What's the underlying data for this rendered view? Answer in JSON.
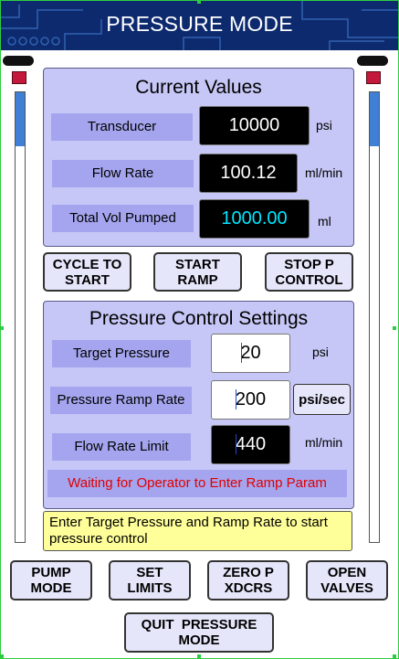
{
  "header": {
    "title": "PRESSURE MODE"
  },
  "current_values": {
    "title": "Current Values",
    "rows": [
      {
        "label": "Transducer",
        "value": "10000",
        "unit": "psi"
      },
      {
        "label": "Flow Rate",
        "value": "100.12",
        "unit": "ml/min"
      },
      {
        "label": "Total Vol Pumped",
        "value": "1000.00",
        "unit": "ml"
      }
    ]
  },
  "mid_buttons": {
    "cycle": [
      "CYCLE TO",
      "START"
    ],
    "ramp": [
      "START",
      "RAMP"
    ],
    "stop": [
      "STOP P",
      "CONTROL"
    ]
  },
  "settings": {
    "title": "Pressure Control Settings",
    "target": {
      "label": "Target Pressure",
      "value": "20",
      "unit": "psi"
    },
    "ramp": {
      "label": "Pressure Ramp Rate",
      "value": "200",
      "unit": "psi/sec"
    },
    "flow": {
      "label": "Flow Rate Limit",
      "value": "440",
      "unit": "ml/min"
    },
    "status": "Waiting for Operator to Enter Ramp Param"
  },
  "note": "Enter Target Pressure and Ramp Rate to start pressure control",
  "bottom_buttons": {
    "pump": [
      "PUMP",
      "MODE"
    ],
    "limits": [
      "SET",
      "LIMITS"
    ],
    "zero": [
      "ZERO P",
      "XDCRS"
    ],
    "valves": [
      "OPEN",
      "VALVES"
    ],
    "quit": [
      "QUIT  PRESSURE",
      "MODE"
    ]
  },
  "colors": {
    "header_bg": "#0d2a6e",
    "panel_bg": "#c6c7f6",
    "label_bg": "#a4a5ee",
    "status_text": "#e00000",
    "note_bg": "#ffff9a",
    "cyan_value": "#00e6ff"
  },
  "gauges": {
    "left_level": 0.12,
    "right_level": 0.12
  }
}
